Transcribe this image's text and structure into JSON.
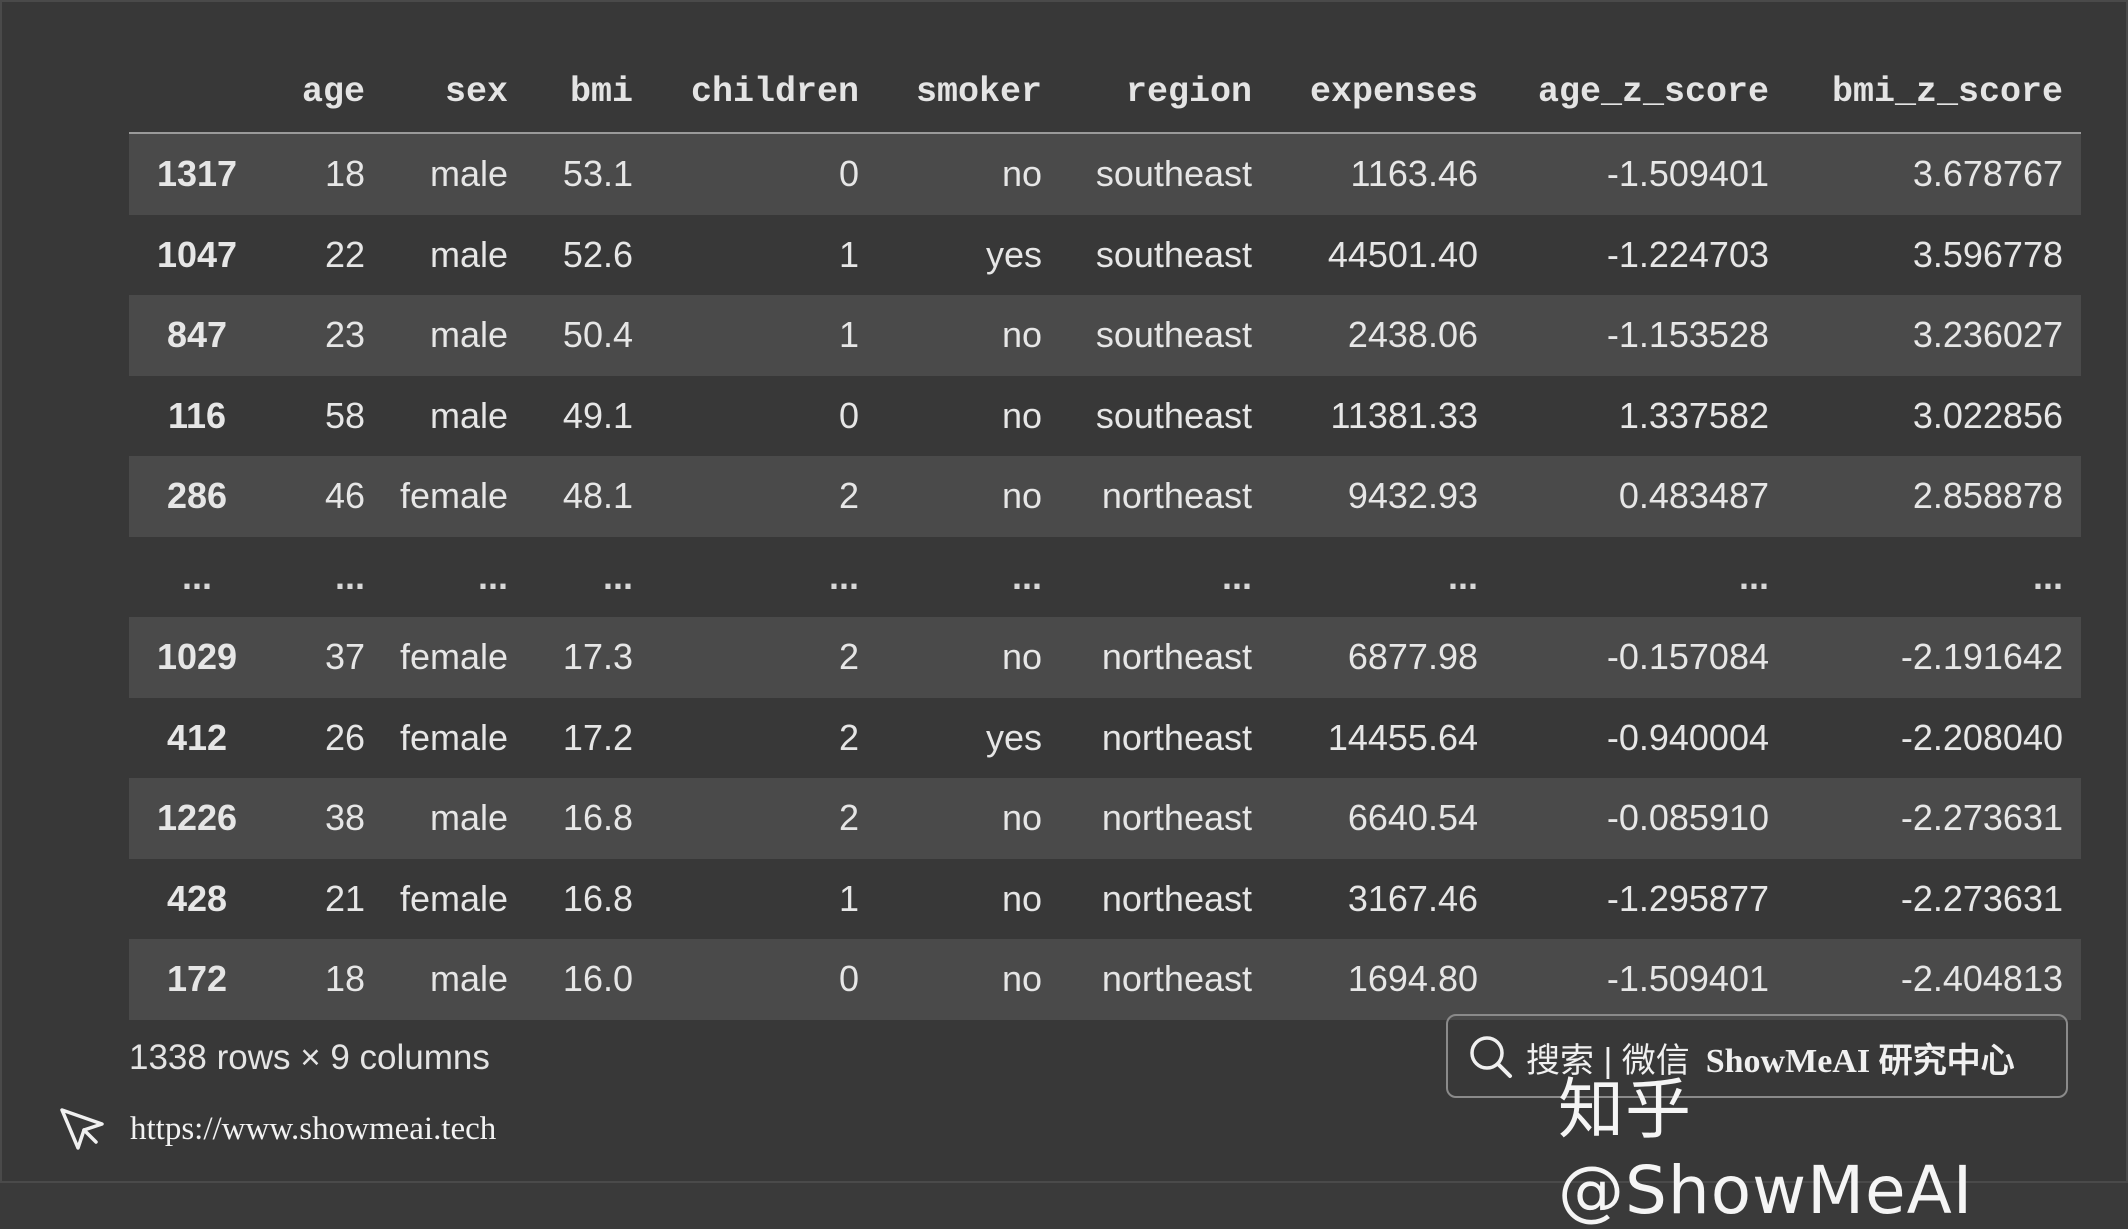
{
  "table": {
    "columns": [
      "",
      "age",
      "sex",
      "bmi",
      "children",
      "smoker",
      "region",
      "expenses",
      "age_z_score",
      "bmi_z_score"
    ],
    "rows": [
      [
        "1317",
        "18",
        "male",
        "53.1",
        "0",
        "no",
        "southeast",
        "1163.46",
        "-1.509401",
        "3.678767"
      ],
      [
        "1047",
        "22",
        "male",
        "52.6",
        "1",
        "yes",
        "southeast",
        "44501.40",
        "-1.224703",
        "3.596778"
      ],
      [
        "847",
        "23",
        "male",
        "50.4",
        "1",
        "no",
        "southeast",
        "2438.06",
        "-1.153528",
        "3.236027"
      ],
      [
        "116",
        "58",
        "male",
        "49.1",
        "0",
        "no",
        "southeast",
        "11381.33",
        "1.337582",
        "3.022856"
      ],
      [
        "286",
        "46",
        "female",
        "48.1",
        "2",
        "no",
        "northeast",
        "9432.93",
        "0.483487",
        "2.858878"
      ],
      [
        "...",
        "...",
        "...",
        "...",
        "...",
        "...",
        "...",
        "...",
        "...",
        "..."
      ],
      [
        "1029",
        "37",
        "female",
        "17.3",
        "2",
        "no",
        "northeast",
        "6877.98",
        "-0.157084",
        "-2.191642"
      ],
      [
        "412",
        "26",
        "female",
        "17.2",
        "2",
        "yes",
        "northeast",
        "14455.64",
        "-0.940004",
        "-2.208040"
      ],
      [
        "1226",
        "38",
        "male",
        "16.8",
        "2",
        "no",
        "northeast",
        "6640.54",
        "-0.085910",
        "-2.273631"
      ],
      [
        "428",
        "21",
        "female",
        "16.8",
        "1",
        "no",
        "northeast",
        "3167.46",
        "-1.295877",
        "-2.273631"
      ],
      [
        "172",
        "18",
        "male",
        "16.0",
        "0",
        "no",
        "northeast",
        "1694.80",
        "-1.509401",
        "-2.404813"
      ]
    ],
    "summary": "1338 rows × 9 columns"
  },
  "footer": {
    "url": "https://www.showmeai.tech",
    "url_icon": "cursor-arrow-icon"
  },
  "watermark": {
    "search_icon": "search-icon",
    "search_text": "搜索 | 微信",
    "brand": "ShowMeAI 研究中心",
    "zhihu": "知乎 @ShowMeAI"
  }
}
